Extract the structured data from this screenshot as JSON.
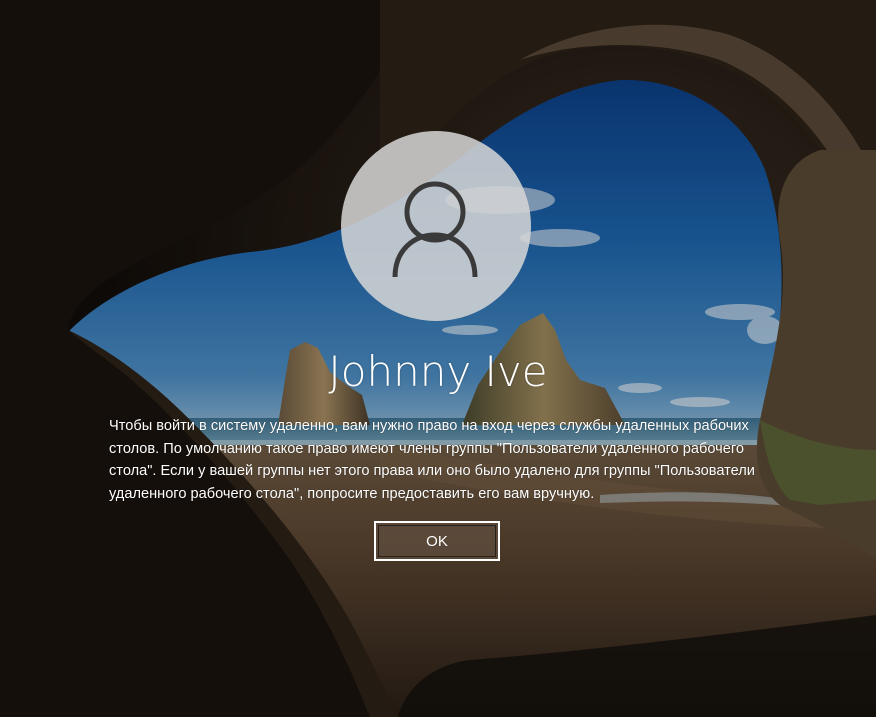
{
  "user": {
    "name": "Johnny Ive",
    "avatar_icon": "user-silhouette-icon"
  },
  "message": {
    "text": "Чтобы войти в систему удаленно, вам нужно право на вход через службы удаленных рабочих столов. По умолчанию такое право имеют члены группы \"Пользователи удаленного рабочего стола\". Если у вашей группы нет этого права или оно было удалено для группы \"Пользователи удаленного рабочего стола\", попросите предоставить его вам вручную."
  },
  "buttons": {
    "ok_label": "OK"
  },
  "colors": {
    "avatar_background": "#d6d6d6",
    "icon_stroke": "#3a3a3a",
    "text": "#ffffff",
    "button_border": "#ffffff"
  }
}
